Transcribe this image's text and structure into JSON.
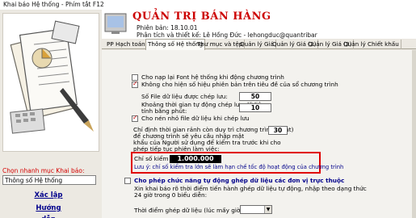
{
  "window": {
    "title": "Khai báo Hệ thống - Phím tắt F12"
  },
  "header": {
    "app_title": "QUẢN TRỊ BÁN HÀNG",
    "version_line": "Phiên bản: 18.10.01",
    "author_line": "Phân tích và thiết kế: Lê Hồng Đức - lehongduc@quantribar"
  },
  "tabs": [
    "PP Hạch toán",
    "Thông số Hệ thống",
    "Thư mục và tệp",
    "Quản lý Giá",
    "Quản lý Giá (2)",
    "Quản lý Giá (3)",
    "Quản lý Chiết khấu"
  ],
  "sidebar": {
    "quick_label": "Chọn nhanh mục Khai báo:",
    "selected_item": "Thông số Hệ thống",
    "setup_button": "Xác lập",
    "guide_button": "Hướng dẫn"
  },
  "settings": {
    "load_font": "Cho nạp lại Font hệ thống khi động chương trình",
    "hide_version": "Không cho hiện số hiệu phiên bản trên tiêu đề của sổ chương trình",
    "backup_count_label": "Số File dữ liệu được chép lưu:",
    "backup_count_value": "50",
    "backup_interval_label_1": "Khoảng thời gian tự động chép lưu dữ liệu",
    "backup_interval_label_2": "tính bằng phút:",
    "backup_interval_value": "10",
    "compress_backup": "Cho nén nhỏ file dữ liệu khi chép lưu",
    "check_time_1": "Chỉ định thời gian rảnh còn duy trì chương trình (phút)",
    "check_time_2": "để chương trình sẽ yêu cầu nhập mật",
    "check_time_3": "khẩu của Người sử dụng để kiểm tra trước khi cho",
    "check_time_4": "phép tiếp tục phiên làm việc:",
    "check_time_value": "30",
    "check_index_label": "Chỉ số kiểm tra:",
    "check_index_value": "1.000.000",
    "note_label": "Lưu ý: chỉ số kiểm tra lớn sẽ làm hạn chế tốc độ hoạt động của chương trình",
    "auto_merge": "Cho phép chức năng tự động ghép dữ liệu các đơn vị trực thuộc",
    "merge_desc_1": "Xin khai báo rõ thời điểm tiến hành ghép dữ liệu tự động, nhập theo dạng thức",
    "merge_desc_2": "24 giờ trong 0 biểu diễn:",
    "merge_time_label": "Thời điểm ghép dữ liệu (lúc mấy giờ?):"
  },
  "colors": {
    "title_red": "#cc0000",
    "highlight_box": "#e00000",
    "check_red": "#c00000",
    "navy": "#00008b"
  },
  "icons": [
    "hero-illustration",
    "window-icon",
    "chevron-down-icon"
  ]
}
